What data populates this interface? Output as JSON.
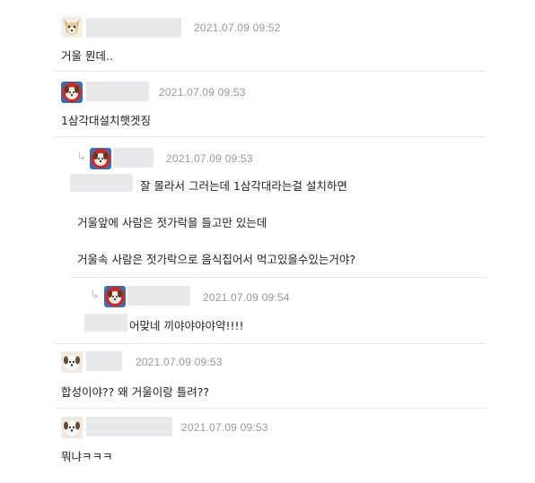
{
  "comments": [
    {
      "timestamp": "2021.07.09 09:52",
      "text": "거울 뭔데..",
      "avatar": "chihuahua-avatar"
    },
    {
      "timestamp": "2021.07.09 09:53",
      "text": "1삼각대설치햇겟징",
      "avatar": "dog-avatar-red"
    },
    {
      "timestamp": "2021.07.09 09:53",
      "reply": true,
      "lines": [
        "잘 몰라서 그러는데 1삼각대라는걸 설치하면",
        "거울앞에 사람은 젓가락을 들고만 있는데",
        "거울속 사람은 젓가락으로 음식집어서 먹고있을수있는거야?"
      ],
      "avatar": "dog-avatar-red"
    },
    {
      "timestamp": "2021.07.09 09:54",
      "reply": true,
      "text": "어맞네 끼야야야야약!!!!",
      "avatar": "dog-avatar-red"
    },
    {
      "timestamp": "2021.07.09 09:53",
      "text": "합성이야?? 왜 거울이랑 틀려??",
      "avatar": "dog-avatar-white"
    },
    {
      "timestamp": "2021.07.09 09:53",
      "text": "뭐냐ㅋㅋㅋ",
      "avatar": "dog-avatar-white"
    }
  ],
  "icons": {
    "reply_arrow": "reply-arrow-icon"
  },
  "colors": {
    "timestamp": "#9a9a9a",
    "separator": "#ececec",
    "redacted": "#e9e9ec"
  }
}
